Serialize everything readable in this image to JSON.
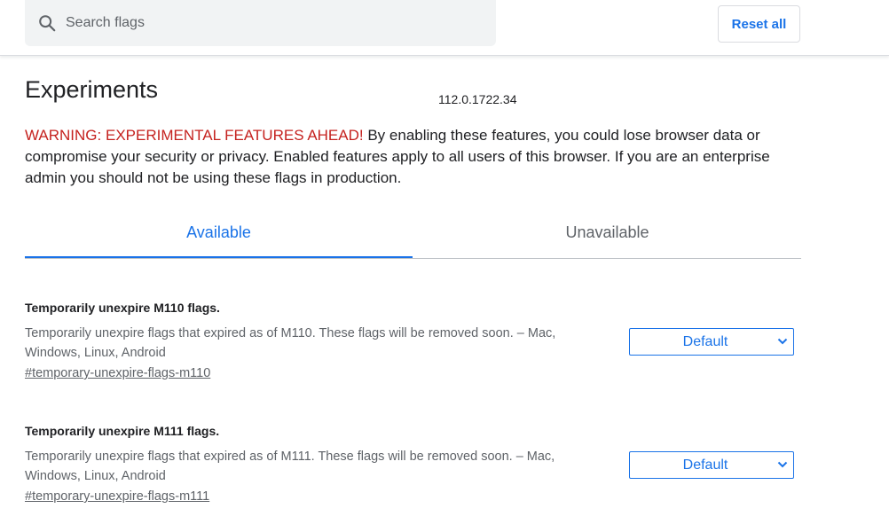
{
  "search": {
    "placeholder": "Search flags",
    "value": "",
    "icon": "search-icon"
  },
  "toolbar": {
    "reset_label": "Reset all"
  },
  "header": {
    "title": "Experiments",
    "version": "112.0.1722.34"
  },
  "warning": {
    "label": "WARNING: EXPERIMENTAL FEATURES AHEAD!",
    "text": " By enabling these features, you could lose browser data or compromise your security or privacy. Enabled features apply to all users of this browser. If you are an enterprise admin you should not be using these flags in production."
  },
  "tabs": [
    {
      "label": "Available",
      "selected": true
    },
    {
      "label": "Unavailable",
      "selected": false
    }
  ],
  "experiments": [
    {
      "name": "Temporarily unexpire M110 flags.",
      "description": "Temporarily unexpire flags that expired as of M110. These flags will be removed soon. – Mac, Windows, Linux, Android",
      "link": "#temporary-unexpire-flags-m110",
      "select_value": "Default"
    },
    {
      "name": "Temporarily unexpire M111 flags.",
      "description": "Temporarily unexpire flags that expired as of M111. These flags will be removed soon. – Mac, Windows, Linux, Android",
      "link": "#temporary-unexpire-flags-m111",
      "select_value": "Default"
    }
  ],
  "colors": {
    "accent": "#1a73e8",
    "warning": "#c5221f",
    "secondary_text": "#5f6368"
  }
}
